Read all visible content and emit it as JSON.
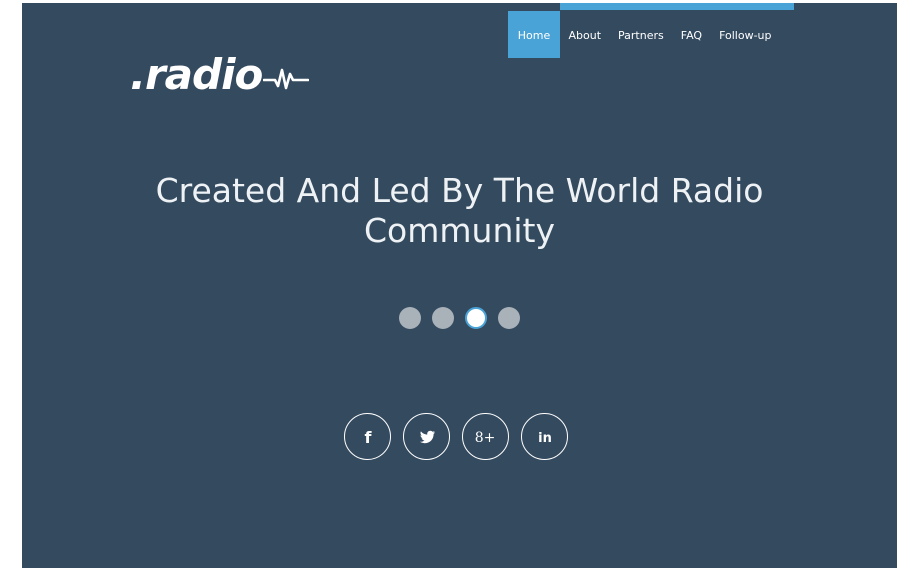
{
  "logo": {
    "text": ".radio",
    "wave_icon": "heartbeat-wave-icon"
  },
  "nav": {
    "items": [
      {
        "label": "Home",
        "active": true
      },
      {
        "label": "About",
        "active": false
      },
      {
        "label": "Partners",
        "active": false
      },
      {
        "label": "FAQ",
        "active": false
      },
      {
        "label": "Follow-up",
        "active": false
      }
    ]
  },
  "hero": {
    "headline_line1": "Created And Led By The World Radio",
    "headline_line2": "Community"
  },
  "slider": {
    "slide_count": 4,
    "active_index": 2
  },
  "social": {
    "icons": [
      "facebook-icon",
      "twitter-icon",
      "google-plus-icon",
      "linkedin-icon"
    ],
    "labels": {
      "facebook": "f",
      "google_plus": "8+",
      "linkedin": "in"
    }
  },
  "colors": {
    "background": "#344a5f",
    "accent": "#4aa3d6",
    "dot_inactive": "#a9b1b9",
    "text": "#ffffff"
  }
}
